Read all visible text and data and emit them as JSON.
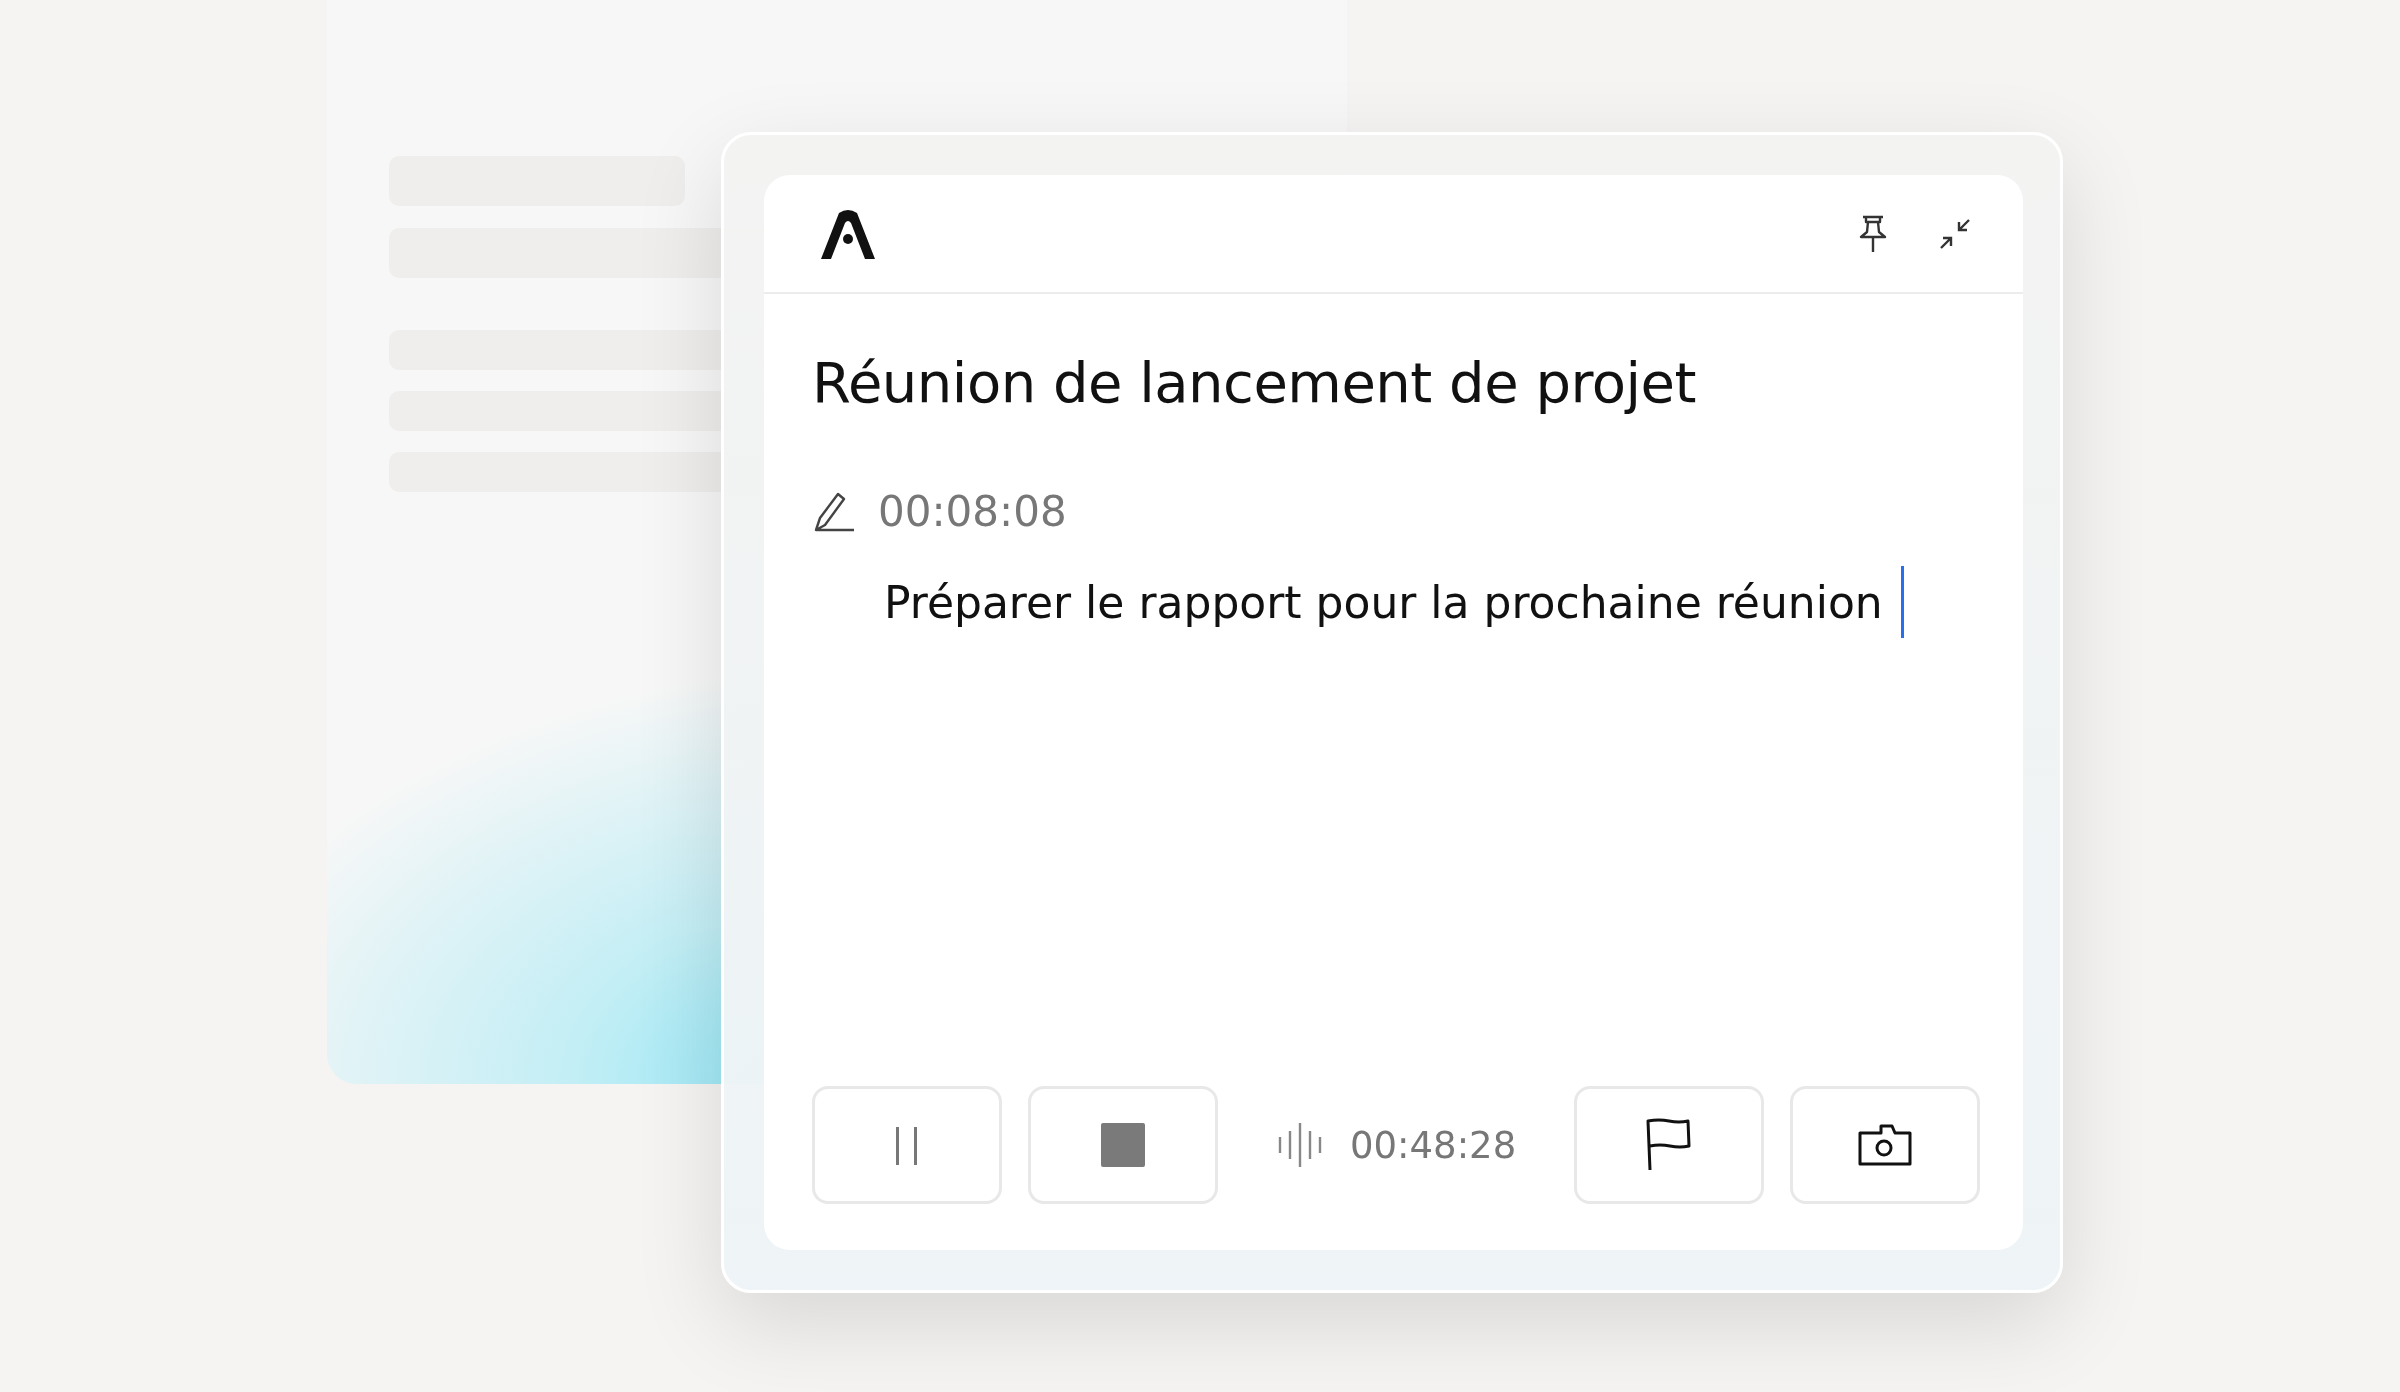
{
  "header": {
    "actions": [
      {
        "kind": "pin"
      },
      {
        "kind": "minimize"
      }
    ]
  },
  "title": "Réunion de lancement de projet",
  "note": {
    "timestamp": "00:08:08",
    "text": "Préparer le rapport pour la prochaine réunion",
    "focused": true
  },
  "recorder": {
    "controls": [
      {
        "kind": "pause"
      },
      {
        "kind": "stop"
      },
      {
        "kind": "elapsed",
        "text": "00:48:28"
      },
      {
        "kind": "flag"
      },
      {
        "kind": "camera"
      }
    ]
  }
}
